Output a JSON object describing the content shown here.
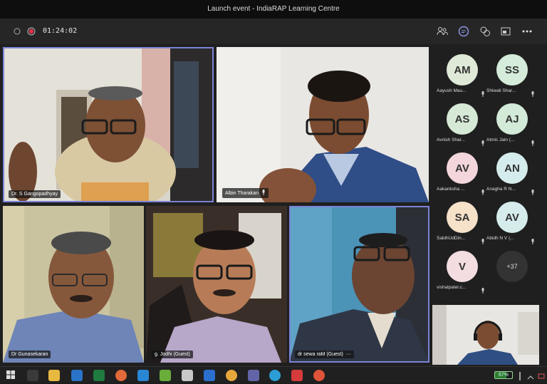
{
  "window": {
    "title": "Launch event - IndiaRAP Learning Centre"
  },
  "toolbar": {
    "timer": "01:24:02"
  },
  "tiles": [
    {
      "name": "Dr. S Gangopadhyay"
    },
    {
      "name": "Albin Tharakan"
    },
    {
      "name": "Dr Gunasekaran"
    },
    {
      "name": "g. Jodhi (Guest)"
    },
    {
      "name": "dr sewa raM (Guest)",
      "more": "···"
    }
  ],
  "participants": [
    {
      "initials": "AM",
      "name": "Aayush Mau...",
      "color": "#dfe9d7"
    },
    {
      "initials": "SS",
      "name": "Shiwali Shar...",
      "color": "#d4ecd9"
    },
    {
      "initials": "AS",
      "name": "Avnish Shar...",
      "color": "#d6e8d6"
    },
    {
      "initials": "AJ",
      "name": "Atmic Jain (...",
      "color": "#d3ead8"
    },
    {
      "initials": "AV",
      "name": "Aakanksha ...",
      "color": "#f3d6dc"
    },
    {
      "initials": "AN",
      "name": "Anagha R N...",
      "color": "#d5ecec"
    },
    {
      "initials": "SA",
      "name": "SabihUdDin...",
      "color": "#f6e1c9"
    },
    {
      "initials": "AV",
      "name": "Abidh N V (...",
      "color": "#d6ecec"
    },
    {
      "initials": "V",
      "name": "vishalpatel.c...",
      "color": "#f3dde0"
    }
  ],
  "roster_more": "+37",
  "taskbar": {
    "battery": "67%",
    "battery_level": 0.67
  }
}
